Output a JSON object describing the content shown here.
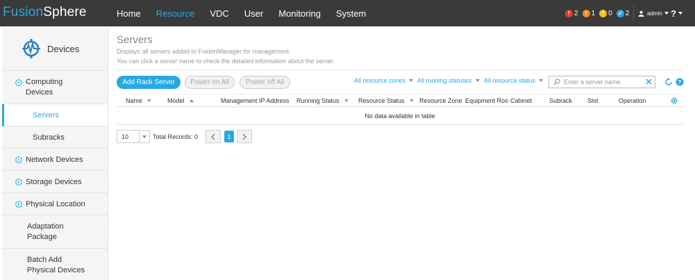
{
  "header": {
    "logo_part1": "Fusion",
    "logo_part2": "Sphere",
    "nav": [
      "Home",
      "Resource",
      "VDC",
      "User",
      "Monitoring",
      "System"
    ],
    "active_nav": "Resource",
    "alarms": [
      {
        "icon": "critical-alarm-icon",
        "count": "2",
        "color": "#e63a3a"
      },
      {
        "icon": "major-alarm-icon",
        "count": "1",
        "color": "#f08c1c"
      },
      {
        "icon": "minor-alarm-icon",
        "count": "0",
        "color": "#f2c21a"
      },
      {
        "icon": "warning-alarm-icon",
        "count": "2",
        "color": "#29a8e0"
      }
    ],
    "user": "admin",
    "help": "?"
  },
  "sidebar": {
    "title": "Devices",
    "items": [
      {
        "label1": "Computing",
        "label2": "Devices"
      },
      {
        "label": "Servers"
      },
      {
        "label": "Subracks"
      },
      {
        "label": "Network Devices"
      },
      {
        "label": "Storage Devices"
      },
      {
        "label": "Physical Location"
      },
      {
        "label1": "Adaptation",
        "label2": "Package"
      },
      {
        "label1": "Batch Add",
        "label2": "Physical Devices"
      }
    ]
  },
  "main": {
    "title": "Servers",
    "desc1": "Displays all servers added to FusionManager for management.",
    "desc2": "You can click a server name to check the detailed information about the server.",
    "buttons": {
      "add": "Add Rack Server",
      "power_on": "Power on All",
      "power_off": "Power off All"
    },
    "filters": {
      "zones": "All resource zones",
      "running": "All running statuses",
      "resource": "All resource status"
    },
    "search_placeholder": "Enter a server name.",
    "columns": [
      "Name",
      "Model",
      "Management IP Address",
      "Running Status",
      "Resource Status",
      "Resource Zone",
      "Equipment Roo",
      "Cabinet",
      "Subrack",
      "Slot",
      "Operation"
    ],
    "empty_text": "No data available in table",
    "pager": {
      "page_size": "10",
      "total": "Total Records: 0",
      "current": "1"
    }
  },
  "colors": {
    "accent": "#29a8e0",
    "topbar": "#3a3a3a"
  }
}
